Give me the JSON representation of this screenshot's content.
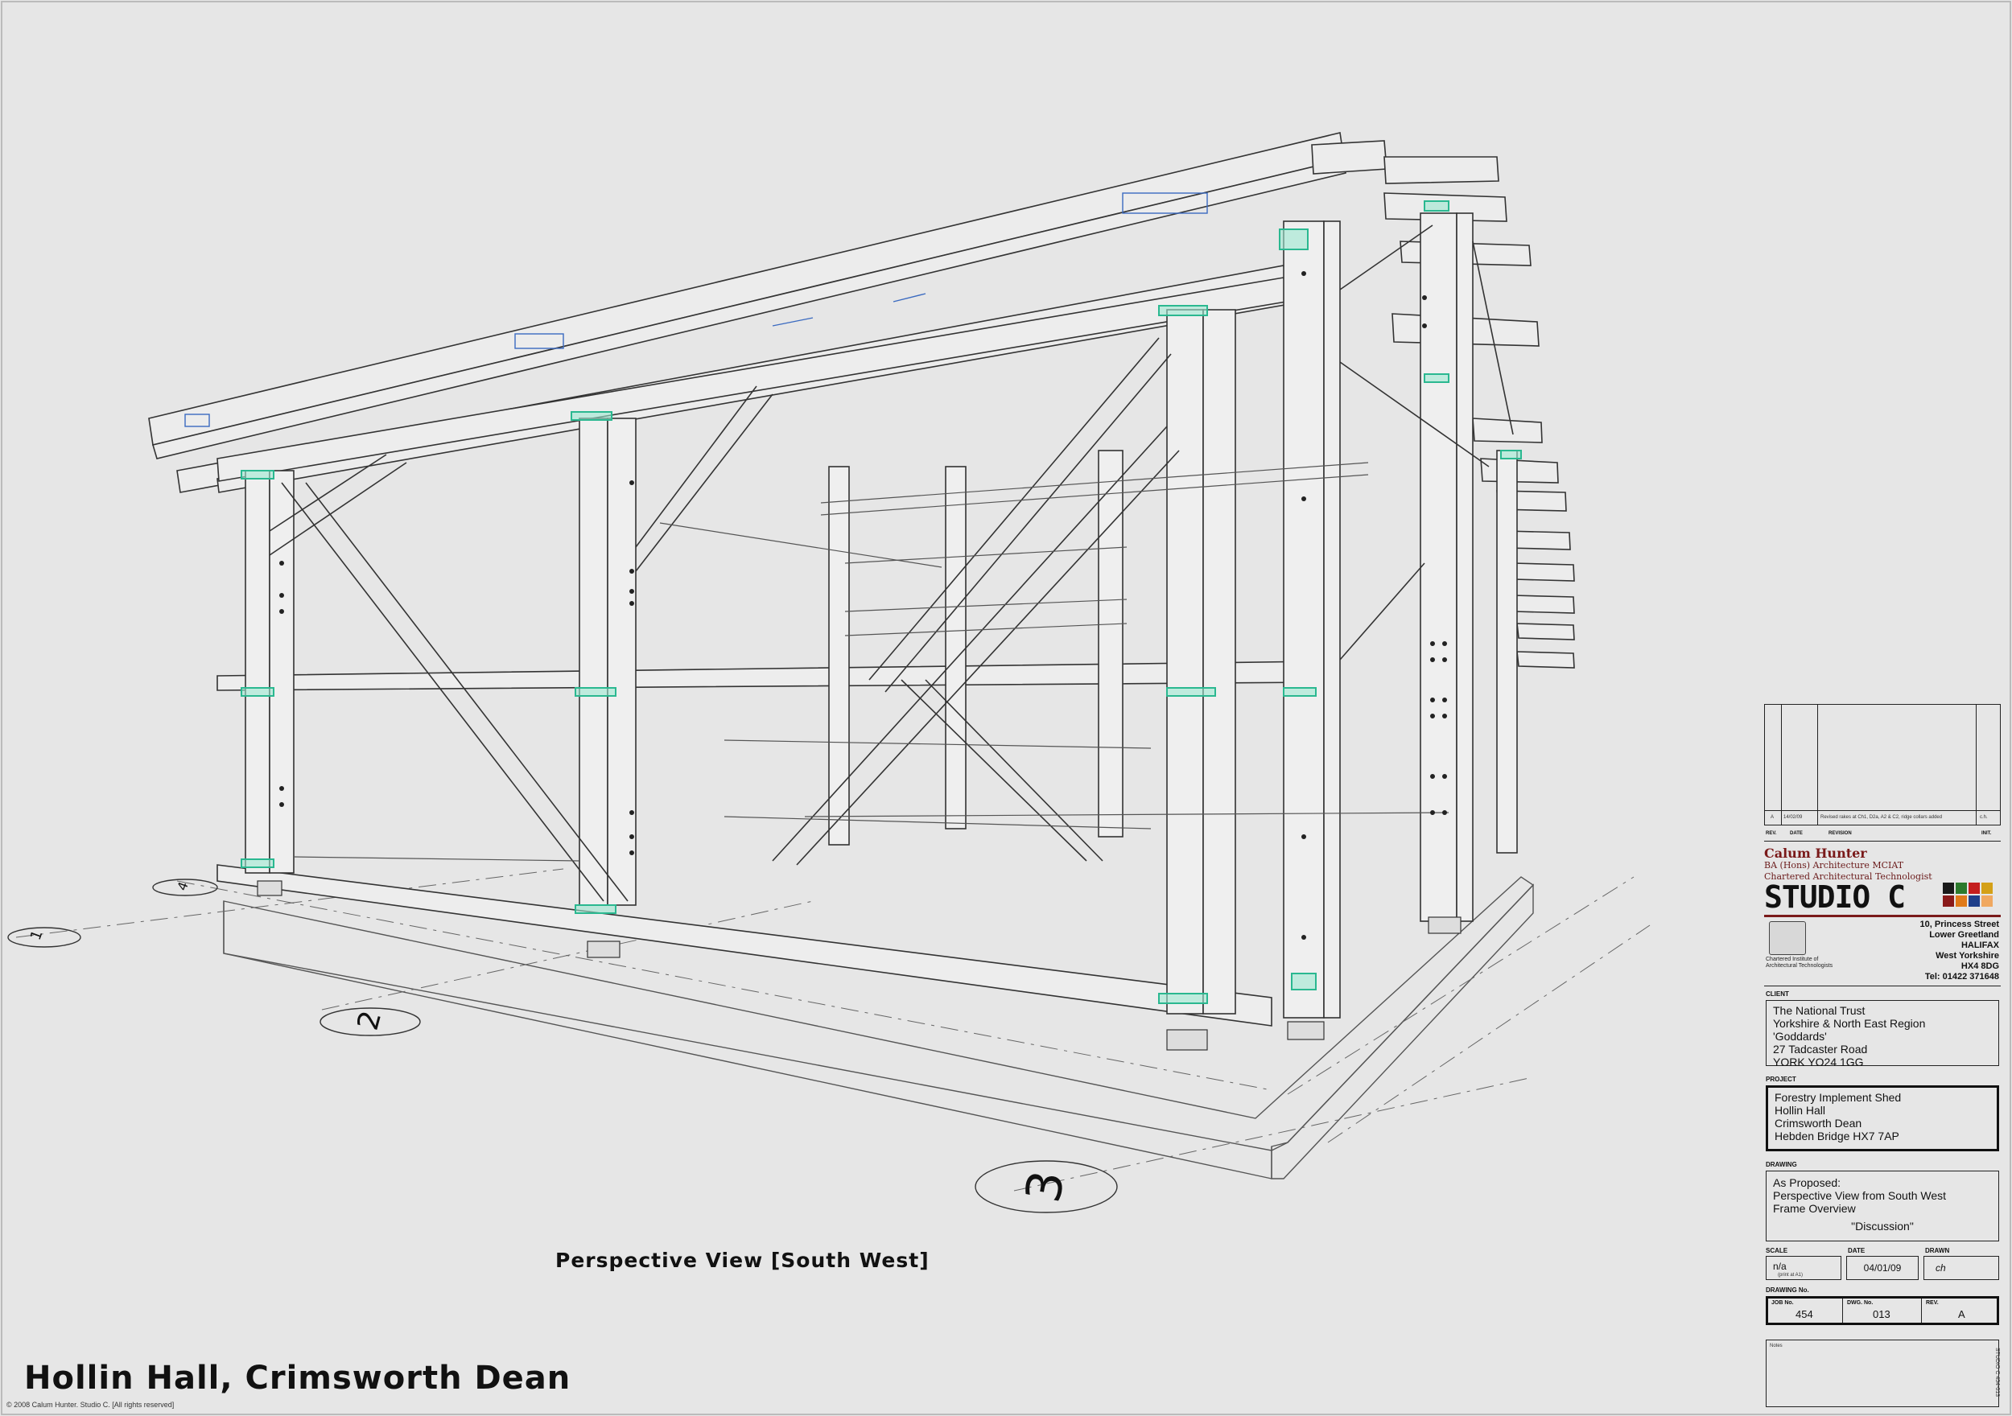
{
  "sheet": {
    "view_title": "Perspective View [South West]",
    "main_title": "Hollin Hall, Crimsworth Dean",
    "copyright": "© 2008 Calum Hunter. Studio C. [All rights reserved]"
  },
  "grid_labels": [
    "1",
    "2",
    "3",
    "4"
  ],
  "title_block": {
    "revision_row": {
      "rev": "A",
      "date": "14/02/09",
      "description": "Revised rakes at Ch1, D2a, A2 & C2, ridge collars added",
      "initials": "c.h."
    },
    "revision_headers": {
      "rev": "REV.",
      "date": "DATE",
      "revision": "REVISION",
      "init": "INIT."
    },
    "practice": {
      "name": "Calum Hunter",
      "qualification": "BA (Hons) Architecture MCIAT",
      "role": "Chartered Architectural Technologist",
      "studio": "STUDIO C",
      "address": [
        "10, Princess Street",
        "Lower Greetland",
        "HALIFAX",
        "West Yorkshire",
        "HX4 8DG"
      ],
      "tel": "Tel:  01422 371648",
      "institute": [
        "Chartered Institute of",
        "Architectural Technologists"
      ]
    },
    "brand_colors": [
      "#1a1a1a",
      "#2c7a2c",
      "#c41e1e",
      "#d4a017",
      "#8a1a1a",
      "#e07a1a",
      "#1f3f8a",
      "#e07a1a",
      "#f0a860"
    ],
    "client_label": "CLIENT",
    "client": [
      "The National Trust",
      "Yorkshire & North East Region",
      "'Goddards'",
      "27 Tadcaster Road",
      "YORK YO24 1GG"
    ],
    "project_label": "PROJECT",
    "project": [
      "Forestry Implement Shed",
      "Hollin Hall",
      "Crimsworth Dean",
      "Hebden Bridge HX7 7AP"
    ],
    "drawing_label": "DRAWING",
    "drawing": [
      "As Proposed:",
      "Perspective View from South West",
      "Frame Overview"
    ],
    "drawing_status": "\"Discussion\"",
    "scale_label": "SCALE",
    "scale": "n/a",
    "scale_note": "(print at A1)",
    "date_label": "DATE",
    "date": "04/01/09",
    "drawn_label": "DRAWN",
    "drawn": "ch",
    "drawing_no_label": "DRAWING No.",
    "job_label": "JOB No.",
    "job": "454",
    "dwg_label": "DWG. No.",
    "dwg": "013",
    "rev_label": "REV.",
    "rev": "A",
    "notes_label": "Notes",
    "side_note": "STUDIO C  454-013"
  }
}
